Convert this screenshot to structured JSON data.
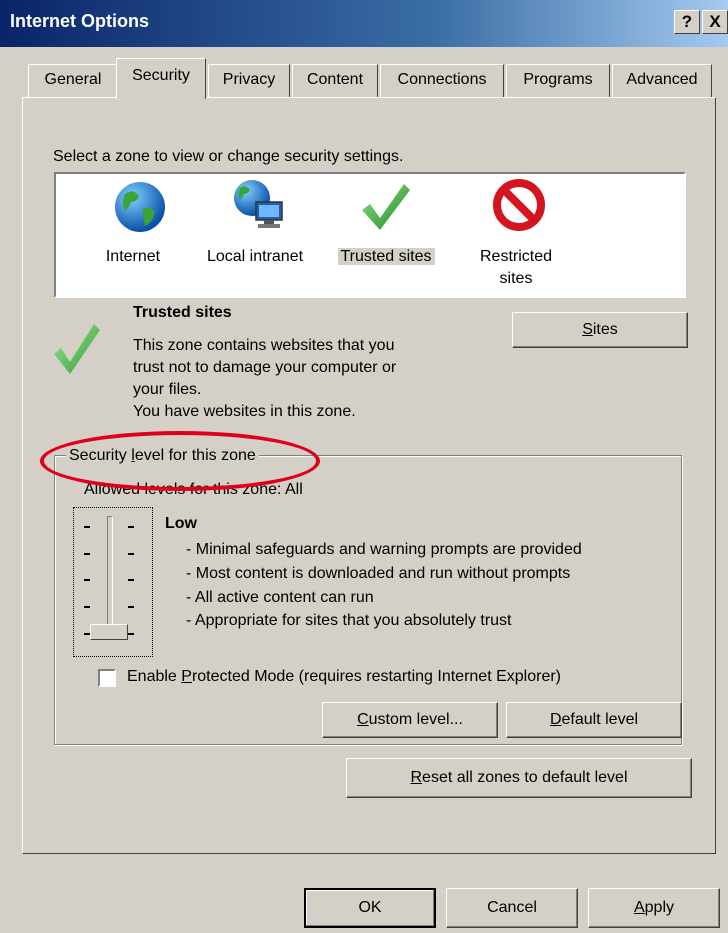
{
  "window": {
    "title": "Internet Options",
    "help_button": "?",
    "close_button": "X"
  },
  "tabs": [
    {
      "label": "General"
    },
    {
      "label": "Security"
    },
    {
      "label": "Privacy"
    },
    {
      "label": "Content"
    },
    {
      "label": "Connections"
    },
    {
      "label": "Programs"
    },
    {
      "label": "Advanced"
    }
  ],
  "zones": {
    "instruction": "Select a zone to view or change security settings.",
    "items": [
      {
        "label": "Internet",
        "icon": "globe-icon"
      },
      {
        "label": "Local intranet",
        "icon": "intranet-icon"
      },
      {
        "label": "Trusted sites",
        "icon": "checkmark-icon"
      },
      {
        "label_line1": "Restricted",
        "label_line2": "sites",
        "icon": "restricted-icon"
      }
    ],
    "selected": "Trusted sites"
  },
  "zone_info": {
    "title": "Trusted sites",
    "desc_line1": "This zone contains websites that you",
    "desc_line2": "trust not to damage your computer or",
    "desc_line3": "your files.",
    "desc_line4": "You have websites in this zone.",
    "sites_button_pre": "",
    "sites_button_accel": "S",
    "sites_button_post": "ites"
  },
  "security_level": {
    "group_pre": "Security ",
    "group_accel": "l",
    "group_post": "evel for this zone",
    "allowed": "Allowed levels for this zone: All",
    "level_name": "Low",
    "bullets": [
      "- Minimal safeguards and warning prompts are provided",
      "- Most content is downloaded and run without prompts",
      "- All active content can run",
      "- Appropriate for sites that you absolutely trust"
    ],
    "protected_mode_pre": "Enable ",
    "protected_mode_accel": "P",
    "protected_mode_post": "rotected Mode (requires restarting Internet Explorer)",
    "protected_mode_checked": false,
    "custom_accel": "C",
    "custom_post": "ustom level...",
    "default_accel": "D",
    "default_post": "efault level"
  },
  "reset_button": {
    "accel": "R",
    "post": "eset all zones to default level"
  },
  "footer": {
    "ok": "OK",
    "cancel": "Cancel",
    "apply_accel": "A",
    "apply_post": "pply"
  },
  "colors": {
    "dialog_bg": "#d4d0c8",
    "title_bar": "#0a246a",
    "highlight_ellipse": "#e0001b"
  }
}
